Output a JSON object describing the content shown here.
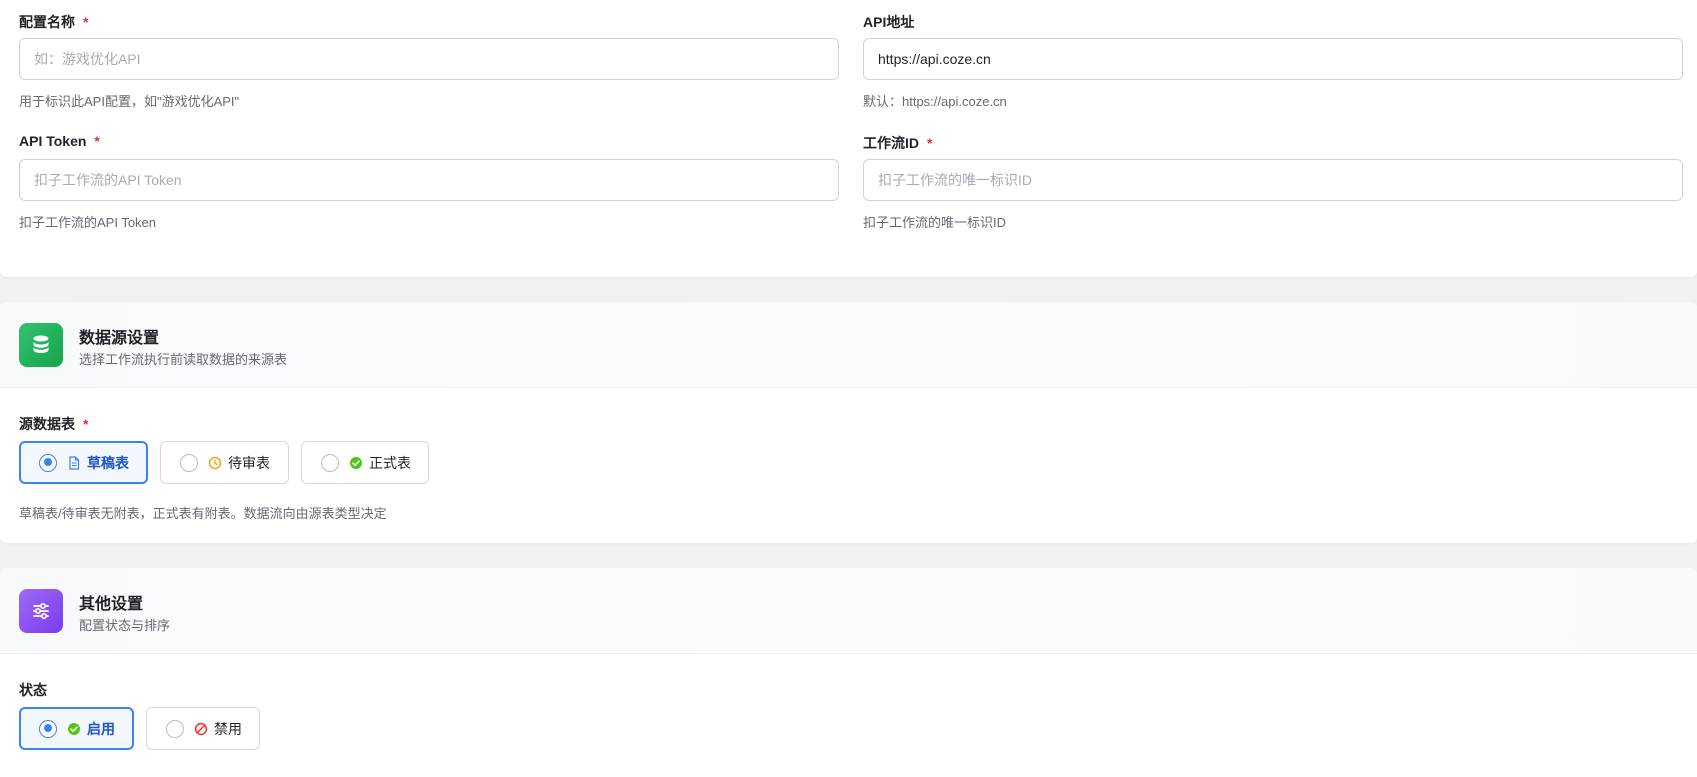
{
  "api_config": {
    "name": {
      "label": "配置名称",
      "required_mark": "*",
      "value": "",
      "placeholder": "如：游戏优化API",
      "help": "用于标识此API配置，如\"游戏优化API\""
    },
    "url": {
      "label": "API地址",
      "value": "https://api.coze.cn",
      "placeholder": "",
      "help": "默认：https://api.coze.cn"
    },
    "token": {
      "label": "API Token",
      "required_mark": "*",
      "value": "",
      "placeholder": "扣子工作流的API Token",
      "help": "扣子工作流的API Token"
    },
    "workflow_id": {
      "label": "工作流ID",
      "required_mark": "*",
      "value": "",
      "placeholder": "扣子工作流的唯一标识ID",
      "help": "扣子工作流的唯一标识ID"
    }
  },
  "datasource": {
    "title": "数据源设置",
    "subtitle": "选择工作流执行前读取数据的来源表",
    "icon": "database-icon",
    "icon_color": "#22b35e",
    "field_label": "源数据表",
    "required_mark": "*",
    "options": [
      {
        "label": "草稿表",
        "icon": "document-icon",
        "icon_color": "#3b82f6",
        "selected": true
      },
      {
        "label": "待审表",
        "icon": "clock-icon",
        "icon_color": "#f5a623",
        "selected": false
      },
      {
        "label": "正式表",
        "icon": "check-circle-icon",
        "icon_color": "#52c41a",
        "selected": false
      }
    ],
    "help": "草稿表/待审表无附表，正式表有附表。数据流向由源表类型决定"
  },
  "other": {
    "title": "其他设置",
    "subtitle": "配置状态与排序",
    "icon": "sliders-icon",
    "icon_color": "#8b5cf6",
    "status_label": "状态",
    "status_options": [
      {
        "label": "启用",
        "icon": "check-circle-icon",
        "icon_color": "#52c41a",
        "selected": true
      },
      {
        "label": "禁用",
        "icon": "ban-icon",
        "icon_color": "#f03e3e",
        "selected": false
      }
    ]
  },
  "colors": {
    "accent": "#3b82f6",
    "required": "#e03131",
    "page_bg": "#f0f1f2"
  }
}
